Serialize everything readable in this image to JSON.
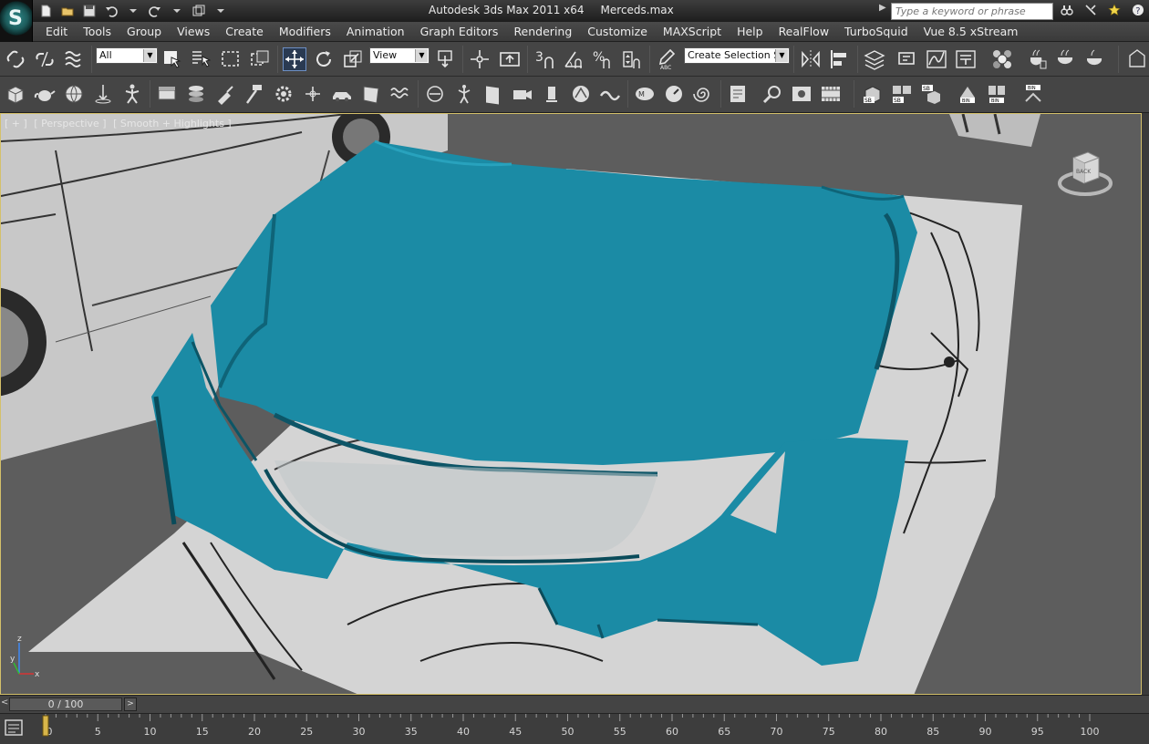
{
  "app": {
    "title": "Autodesk 3ds Max  2011 x64",
    "file": "Merceds.max",
    "logo_letter": "S",
    "search_placeholder": "Type a keyword or phrase"
  },
  "menu": [
    "Edit",
    "Tools",
    "Group",
    "Views",
    "Create",
    "Modifiers",
    "Animation",
    "Graph Editors",
    "Rendering",
    "Customize",
    "MAXScript",
    "Help",
    "RealFlow",
    "TurboSquid",
    "Vue 8.5 xStream"
  ],
  "toolbar": {
    "selection_filter": "All",
    "reference_coord": "View",
    "named_selection": "Create Selection Se",
    "snap_3": "3"
  },
  "viewport": {
    "labels": [
      "[ + ]",
      "[ Perspective ]",
      "[ Smooth + Highlights ]"
    ],
    "viewcube_face": "BACK",
    "axis_labels": {
      "y": "y",
      "z": "z",
      "x": "x"
    },
    "model_color": "#1a8aa4"
  },
  "timeline": {
    "frame_display": "0 / 100",
    "prev_symbol": "<",
    "next_symbol": ">",
    "current_frame": 0,
    "ticks": [
      "0",
      "5",
      "10",
      "15",
      "20",
      "25",
      "30",
      "35",
      "40",
      "45",
      "50",
      "55",
      "60",
      "65",
      "70",
      "75",
      "80",
      "85",
      "90",
      "95",
      "100"
    ]
  }
}
